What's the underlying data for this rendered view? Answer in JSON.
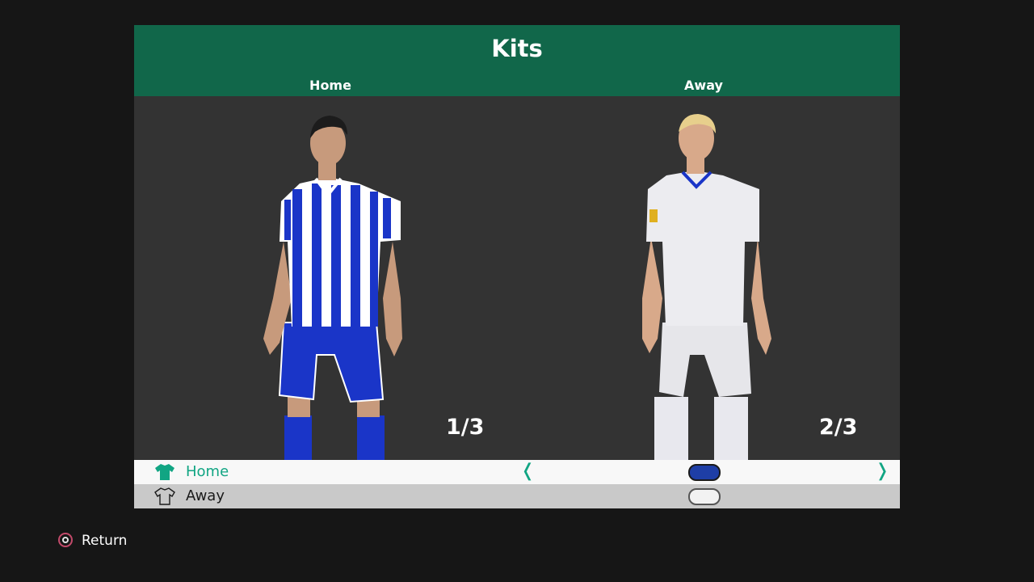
{
  "panel": {
    "title": "Kits",
    "columns": [
      {
        "label": "Home",
        "counter": "1/3"
      },
      {
        "label": "Away",
        "counter": "2/3"
      }
    ]
  },
  "kit_list": [
    {
      "label": "Home",
      "icon": "shirt-filled-icon",
      "selected": true,
      "pill": "filled"
    },
    {
      "label": "Away",
      "icon": "shirt-outline-icon",
      "selected": false,
      "pill": "outline"
    }
  ],
  "arrows": {
    "left": "❬",
    "right": "❭"
  },
  "footer": {
    "return_label": "Return",
    "button_icon": "circle-button-icon"
  },
  "colors": {
    "header": "#11674a",
    "accent": "#11a583",
    "home_kit_primary": "#1a35c8",
    "selected_pill": "#1e3ea6"
  }
}
